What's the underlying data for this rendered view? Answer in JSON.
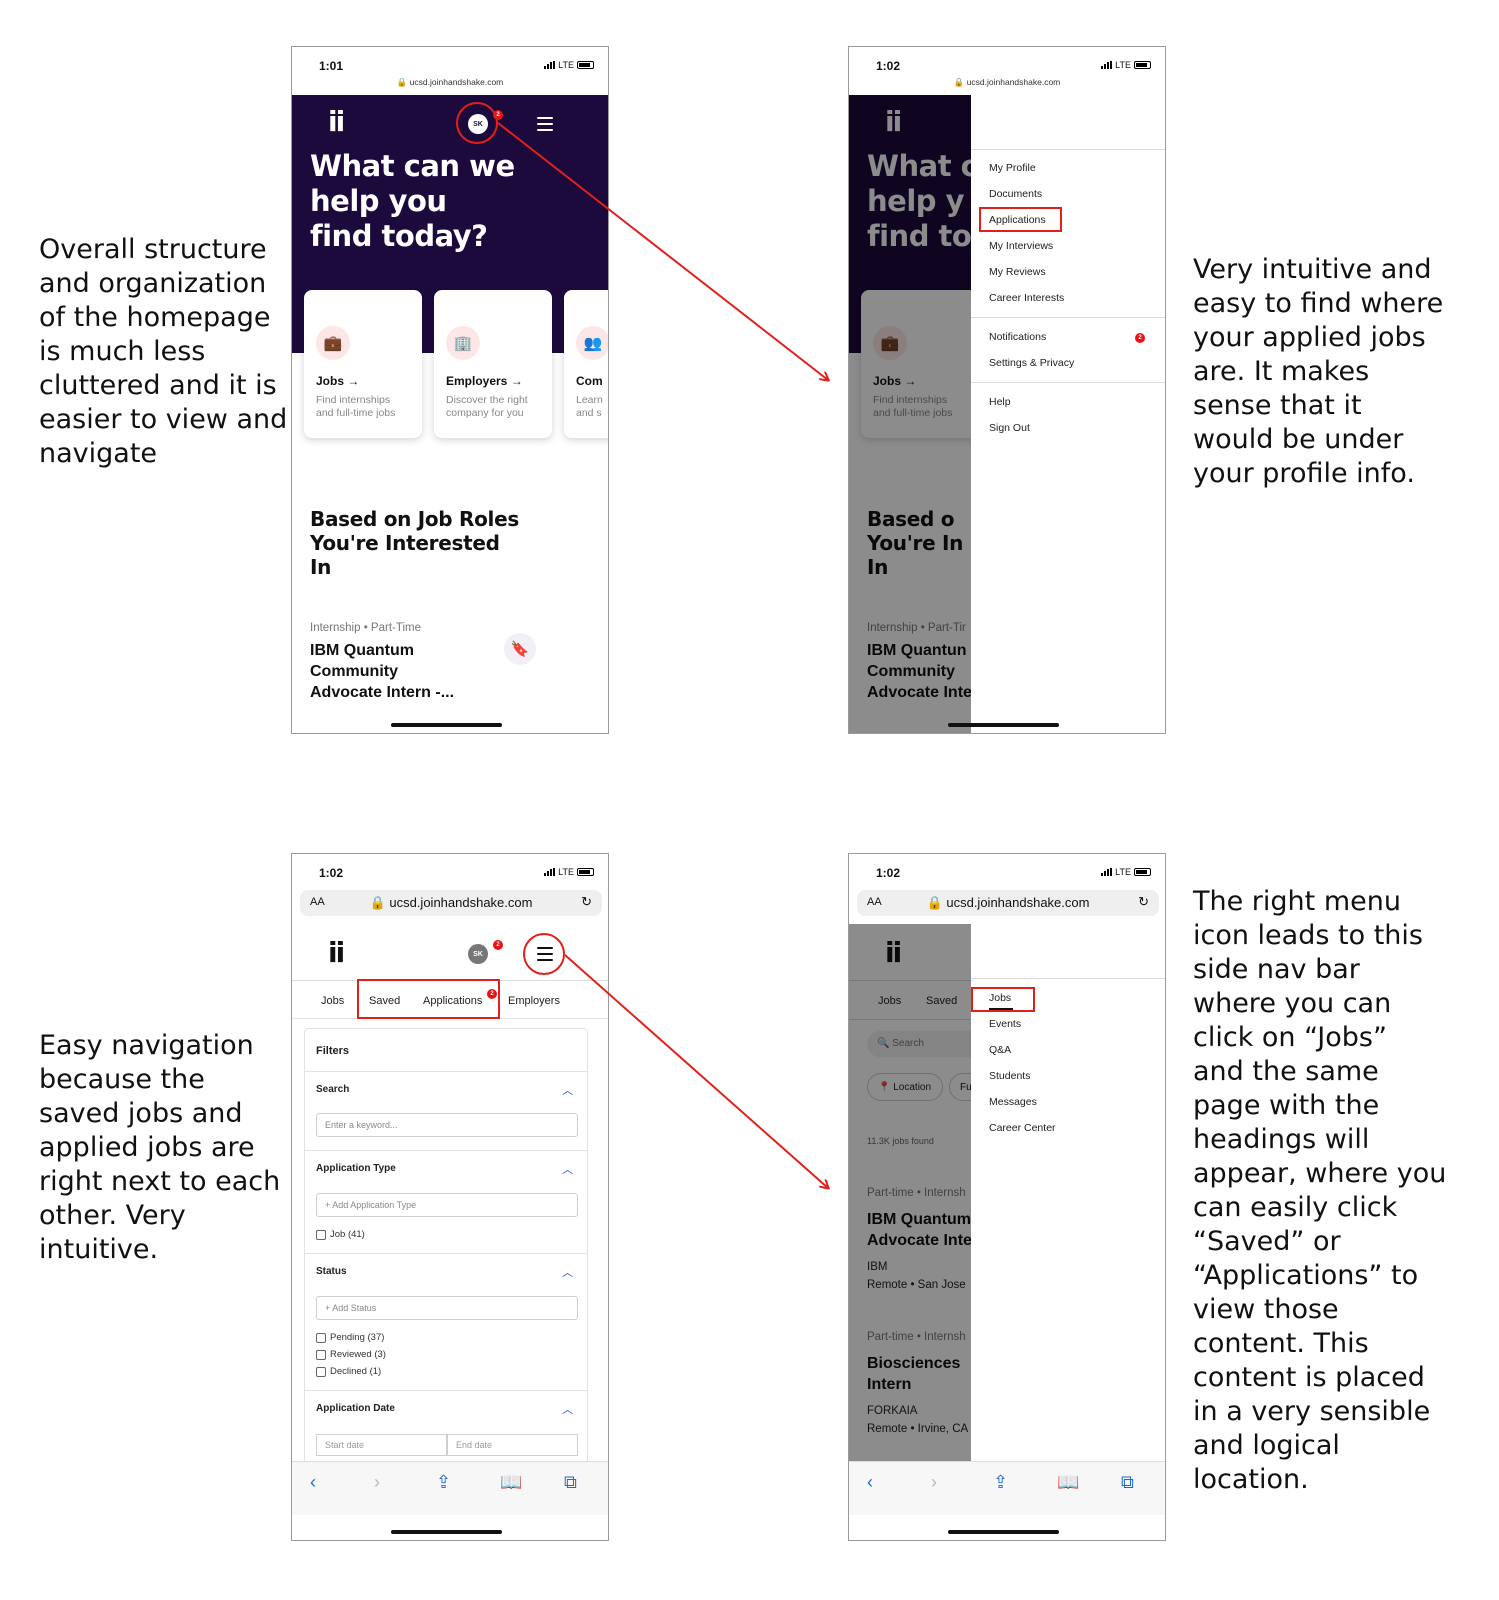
{
  "annotations": {
    "top_left": "Overall structure\nand organization\nof the homepage\nis much less\ncluttered and it is\neasier to view and\nnavigate",
    "top_right": "Very intuitive and\neasy to find where\nyour applied jobs\nare. It makes\nsense that it\nwould be under\nyour profile info.",
    "bottom_left": "Easy navigation\nbecause the\nsaved jobs and\napplied jobs are\nright next to each\nother. Very\nintuitive.",
    "bottom_right": "The right menu\nicon leads to this\nside nav bar\nwhere you can\nclick on “Jobs”\nand the same\npage with the\nheadings will\nappear, where you\ncan easily click\n“Saved” or\n“Applications” to\nview those\ncontent. This\ncontent is placed\nin a very sensible\nand logical\nlocation."
  },
  "colors": {
    "hero": "#1d0a3d",
    "accent_red": "#e2201a",
    "link_blue": "#1a6ad8"
  },
  "phone1": {
    "time": "1:01",
    "network": "LTE",
    "url": "ucsd.joinhandshake.com",
    "logo": "ii",
    "avatar": "SK",
    "badge": "2",
    "hero_title": "What can we\nhelp you\nfind today?",
    "cards": [
      {
        "icon": "briefcase-icon",
        "title": "Jobs →",
        "desc": "Find internships\nand full-time jobs"
      },
      {
        "icon": "building-icon",
        "title": "Employers →",
        "desc": "Discover the right\ncompany for you"
      },
      {
        "icon": "people-icon",
        "title": "Com",
        "desc": "Learn\nand s"
      }
    ],
    "section_heading": "Based on Job Roles\nYou're Interested\nIn",
    "job_meta": "Internship • Part-Time",
    "job_title": "IBM Quantum\nCommunity\nAdvocate Intern -..."
  },
  "phone2": {
    "time": "1:02",
    "network": "LTE",
    "url": "ucsd.joinhandshake.com",
    "logo": "ii",
    "hero_title": "What c\nhelp y\nfind to",
    "card_title": "Jobs →",
    "card_desc": "Find internships\nand full-time jobs",
    "section_heading": "Based o\nYou're In\nIn",
    "job_meta": "Internship • Part-Tir",
    "job_title": "IBM Quantun\nCommunity\nAdvocate Inte",
    "menu": {
      "group1": [
        "My Profile",
        "Documents",
        "Applications",
        "My Interviews",
        "My Reviews",
        "Career Interests"
      ],
      "group2": [
        "Notifications",
        "Settings & Privacy"
      ],
      "group3": [
        "Help",
        "Sign Out"
      ],
      "notif_badge": "2"
    }
  },
  "phone3": {
    "time": "1:02",
    "network": "LTE",
    "url_aa": "AA",
    "url": "ucsd.joinhandshake.com",
    "logo": "ii",
    "avatar": "SK",
    "badge": "2",
    "tabs": [
      "Jobs",
      "Saved",
      "Applications",
      "Employers"
    ],
    "tab_badge": "2",
    "filters": {
      "title": "Filters",
      "search_label": "Search",
      "search_placeholder": "Enter a keyword...",
      "app_type_label": "Application Type",
      "app_type_add": "+ Add Application Type",
      "app_type_option": "Job (41)",
      "status_label": "Status",
      "status_add": "+ Add Status",
      "status_options": [
        "Pending (37)",
        "Reviewed (3)",
        "Declined (1)"
      ],
      "date_label": "Application Date",
      "start_date": "Start date",
      "end_date": "End date"
    }
  },
  "phone4": {
    "time": "1:02",
    "network": "LTE",
    "url_aa": "AA",
    "url": "ucsd.joinhandshake.com",
    "logo": "ii",
    "tabs": [
      "Jobs",
      "Saved"
    ],
    "search_placeholder": "Search",
    "location_chip": "Location",
    "second_chip": "Fu",
    "jobs_found": "11.3K jobs found",
    "jobs": [
      {
        "meta": "Part-time • Internsh",
        "title": "IBM Quantum\nAdvocate Inte",
        "company": "IBM",
        "location": "Remote • San Jose"
      },
      {
        "meta": "Part-time • Internsh",
        "title": "Biosciences\nIntern",
        "company": "FORKAIA",
        "location": "Remote • Irvine, CA"
      }
    ],
    "menu": [
      "Jobs",
      "Events",
      "Q&A",
      "Students",
      "Messages",
      "Career Center"
    ]
  }
}
